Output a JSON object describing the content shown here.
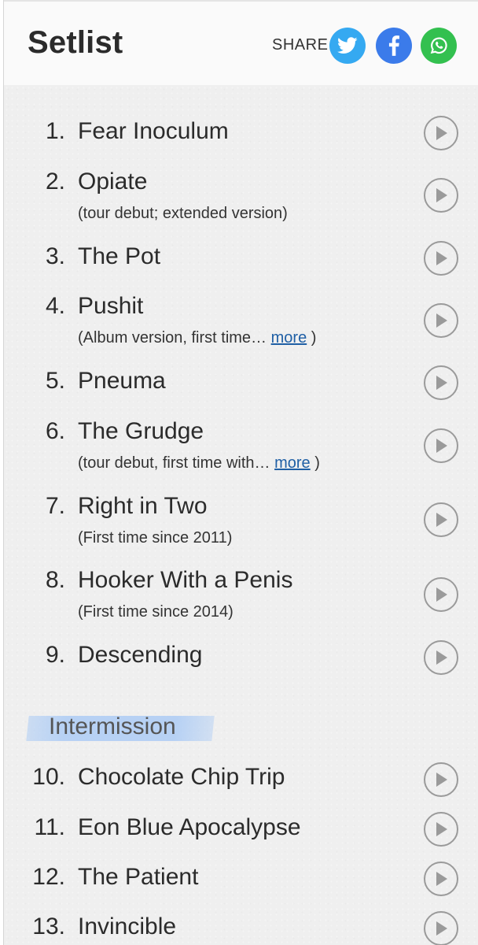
{
  "header": {
    "title": "Setlist",
    "share_label": "SHARE",
    "share_buttons": [
      {
        "icon": "twitter-icon",
        "color": "#35a9f1"
      },
      {
        "icon": "facebook-icon",
        "color": "#3b7bea"
      },
      {
        "icon": "whatsapp-icon",
        "color": "#33c04f"
      }
    ]
  },
  "songs": [
    {
      "num": "1.",
      "name": "Fear Inoculum",
      "note": ""
    },
    {
      "num": "2.",
      "name": "Opiate",
      "note": "(tour debut; extended version)"
    },
    {
      "num": "3.",
      "name": "The Pot",
      "note": ""
    },
    {
      "num": "4.",
      "name": "Pushit",
      "note_prefix": "(Album version, first time…",
      "more": "more",
      "note_suffix": ")"
    },
    {
      "num": "5.",
      "name": "Pneuma",
      "note": ""
    },
    {
      "num": "6.",
      "name": "The Grudge",
      "note_prefix": "(tour debut, first time with…",
      "more": "more",
      "note_suffix": ")"
    },
    {
      "num": "7.",
      "name": "Right in Two",
      "note": "(First time since 2011)"
    },
    {
      "num": "8.",
      "name": "Hooker With a Penis",
      "note": "(First time since 2014)"
    },
    {
      "num": "9.",
      "name": "Descending",
      "note": ""
    },
    {
      "num": "10.",
      "name": "Chocolate Chip Trip",
      "note": ""
    },
    {
      "num": "11.",
      "name": "Eon Blue Apocalypse",
      "note": ""
    },
    {
      "num": "12.",
      "name": "The Patient",
      "note": ""
    },
    {
      "num": "13.",
      "name": "Invincible",
      "note": ""
    }
  ],
  "intermission": {
    "label": "Intermission",
    "highlight_color": "#adccf5"
  },
  "play_icon": "play-icon"
}
